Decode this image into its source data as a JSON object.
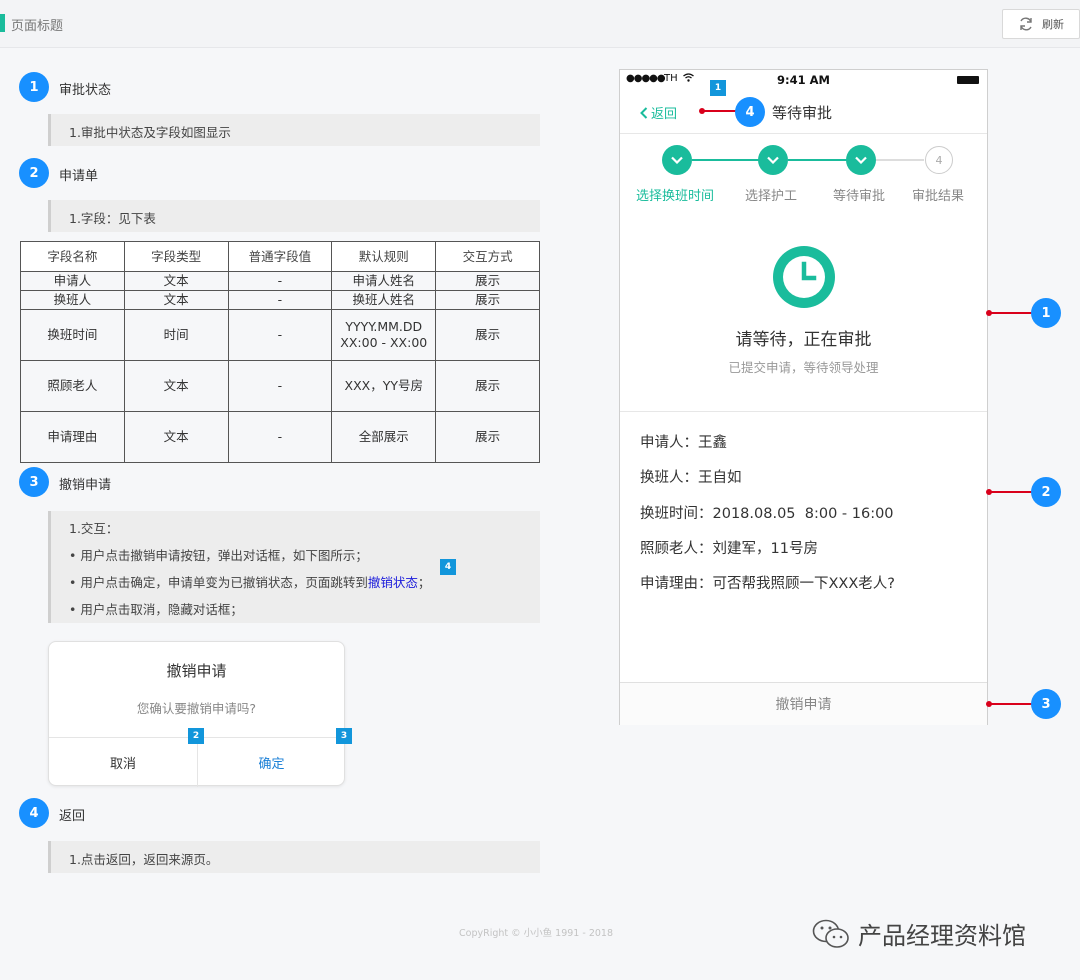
{
  "header": {
    "title": "页面标题",
    "refresh_label": "刷新"
  },
  "sections": {
    "s1": {
      "num": "1",
      "title": "审批状态",
      "note": "1.审批中状态及字段如图显示"
    },
    "s2": {
      "num": "2",
      "title": "申请单",
      "note": "1.字段：见下表"
    },
    "s3": {
      "num": "3",
      "title": "撤销申请",
      "lines": [
        "1.交互：",
        "• 用户点击撤销申请按钮，弹出对话框，如下图所示；",
        "• 用户点击确定，申请单变为已撤销状态，页面跳转到",
        "；",
        "• 用户点击取消，隐藏对话框；"
      ],
      "link": "撤销状态"
    },
    "s4": {
      "num": "4",
      "title": "返回",
      "note": "1.点击返回，返回来源页。"
    }
  },
  "table": {
    "headers": [
      "字段名称",
      "字段类型",
      "普通字段值",
      "默认规则",
      "交互方式"
    ],
    "rows": [
      [
        "申请人",
        "文本",
        "-",
        "申请人姓名",
        "展示"
      ],
      [
        "换班人",
        "文本",
        "-",
        "换班人姓名",
        "展示"
      ],
      [
        "换班时间",
        "时间",
        "-",
        "YYYY.MM.DD",
        "展示"
      ],
      [
        "照顾老人",
        "文本",
        "-",
        "XXX，YY号房",
        "展示"
      ],
      [
        "申请理由",
        "文本",
        "-",
        "全部展示",
        "展示"
      ]
    ],
    "row3_rule_line2": "XX:00 - XX:00"
  },
  "dialog": {
    "title": "撤销申请",
    "message": "您确认要撤销申请吗?",
    "cancel": "取消",
    "confirm": "确定"
  },
  "tags": {
    "t1": "1",
    "t2": "2",
    "t3": "3",
    "t4": "4"
  },
  "phone": {
    "status": {
      "signal": "●●●●●",
      "carrier": "TH",
      "time": "9:41 AM"
    },
    "nav": {
      "back": "返回",
      "title": "等待审批",
      "badge": "4"
    },
    "steps": [
      {
        "label": "选择换班时间",
        "state": "done"
      },
      {
        "label": "选择护工",
        "state": "done"
      },
      {
        "label": "等待审批",
        "state": "done"
      },
      {
        "label": "审批结果",
        "state": "todo",
        "num": "4"
      }
    ],
    "status_main": "请等待，正在审批",
    "status_sub": "已提交申请，等待领导处理",
    "info": [
      {
        "label": "申请人：",
        "value": "王鑫"
      },
      {
        "label": "换班人：",
        "value": "王自如"
      },
      {
        "label": "换班时间：",
        "value": "2018.08.05  8:00 - 16:00"
      },
      {
        "label": "照顾老人：",
        "value": "刘建军，11号房"
      },
      {
        "label": "申请理由：",
        "value": "可否帮我照顾一下XXX老人?"
      }
    ],
    "cancel_button": "撤销申请"
  },
  "callouts": {
    "c1": "1",
    "c2": "2",
    "c3": "3"
  },
  "footer": {
    "copyright": "CopyRight © 小小鱼  1991 - 2018",
    "watermark": "产品经理资料馆"
  },
  "colors": {
    "accent": "#1abc9c",
    "badge": "#1890ff",
    "pointer": "#d9001b"
  }
}
